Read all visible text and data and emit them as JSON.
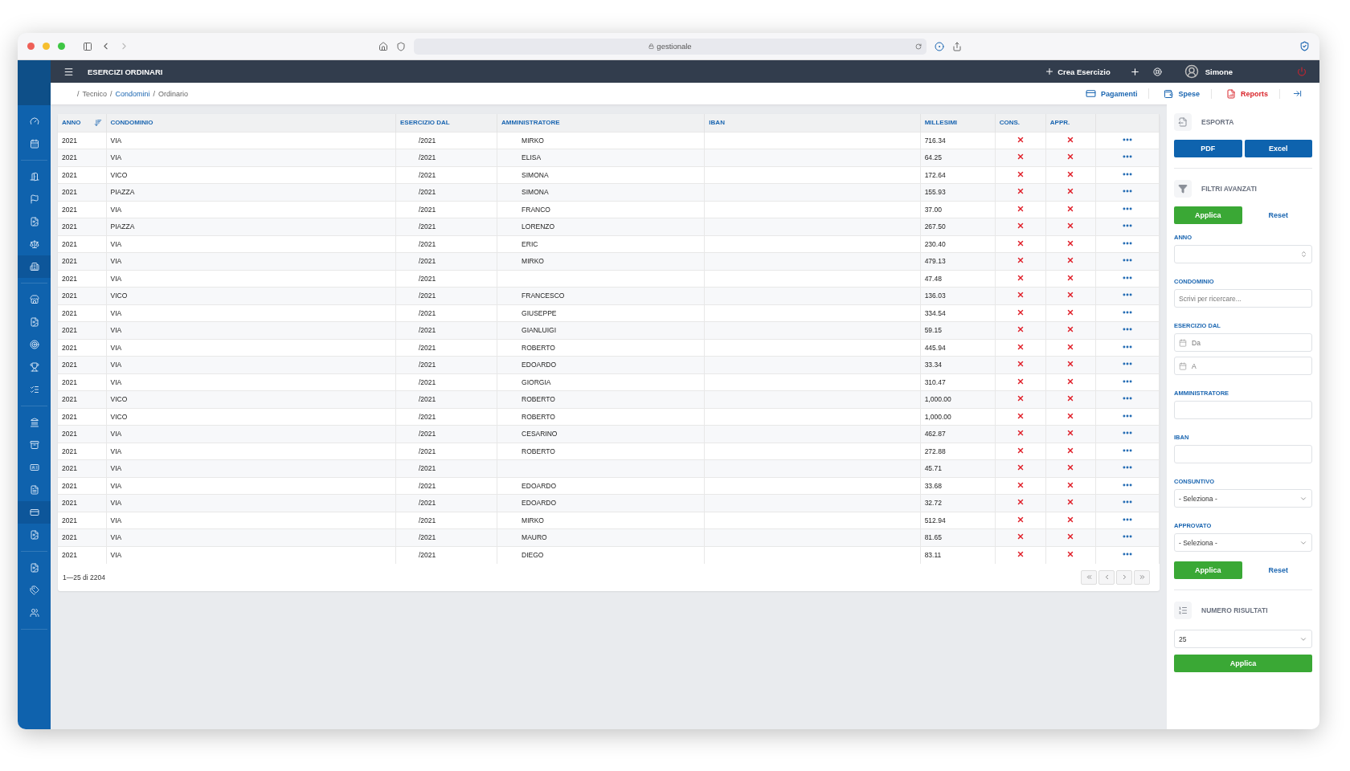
{
  "browser": {
    "url": "gestionale"
  },
  "header": {
    "title": "ESERCIZI ORDINARI",
    "create_label": "Crea Esercizio",
    "user": "Simone"
  },
  "breadcrumb": [
    {
      "label": "/",
      "kind": "sep"
    },
    {
      "label": "Tecnico",
      "kind": "text"
    },
    {
      "label": "/",
      "kind": "sep"
    },
    {
      "label": "Condomini",
      "kind": "link"
    },
    {
      "label": "/",
      "kind": "sep"
    },
    {
      "label": "Ordinario",
      "kind": "text"
    }
  ],
  "quick_links": [
    {
      "label": "Pagamenti",
      "kind": "payments"
    },
    {
      "label": "Spese",
      "kind": "expenses"
    },
    {
      "label": "Reports",
      "kind": "reports"
    }
  ],
  "sidebar": {
    "groups": [
      [
        {
          "selected": false
        },
        {
          "selected": false
        }
      ],
      [
        {
          "selected": false
        },
        {
          "selected": false
        },
        {
          "selected": false
        },
        {
          "selected": false
        },
        {
          "selected": true
        }
      ],
      [
        {
          "selected": false
        },
        {
          "selected": false
        },
        {
          "selected": false
        },
        {
          "selected": false
        },
        {
          "selected": false
        }
      ],
      [
        {
          "selected": false
        },
        {
          "selected": false
        },
        {
          "selected": false
        },
        {
          "selected": false
        },
        {
          "selected": true
        },
        {
          "selected": false
        }
      ],
      [
        {
          "selected": false
        },
        {
          "selected": false
        },
        {
          "selected": false
        }
      ]
    ]
  },
  "table": {
    "columns": [
      "ANNO",
      "CONDOMINIO",
      "ESERCIZIO DAL",
      "AMMINISTRATORE",
      "IBAN",
      "MILLESIMI",
      "CONS.",
      "APPR."
    ],
    "rows": [
      {
        "anno": "2021",
        "condominio": "VIA",
        "esercizio": "/2021",
        "amministratore": "MIRKO",
        "millesimi": "716.34",
        "cons": false,
        "appr": false
      },
      {
        "anno": "2021",
        "condominio": "VIA",
        "esercizio": "/2021",
        "amministratore": "ELISA",
        "millesimi": "64.25",
        "cons": false,
        "appr": false
      },
      {
        "anno": "2021",
        "condominio": "VICO",
        "esercizio": "/2021",
        "amministratore": "SIMONA",
        "millesimi": "172.64",
        "cons": false,
        "appr": false
      },
      {
        "anno": "2021",
        "condominio": "PIAZZA",
        "esercizio": "/2021",
        "amministratore": "SIMONA",
        "millesimi": "155.93",
        "cons": false,
        "appr": false
      },
      {
        "anno": "2021",
        "condominio": "VIA",
        "esercizio": "/2021",
        "amministratore": "FRANCO",
        "millesimi": "37.00",
        "cons": false,
        "appr": false
      },
      {
        "anno": "2021",
        "condominio": "PIAZZA",
        "esercizio": "/2021",
        "amministratore": "LORENZO",
        "millesimi": "267.50",
        "cons": false,
        "appr": false
      },
      {
        "anno": "2021",
        "condominio": "VIA",
        "esercizio": "/2021",
        "amministratore": "ERIC",
        "millesimi": "230.40",
        "cons": false,
        "appr": false
      },
      {
        "anno": "2021",
        "condominio": "VIA",
        "esercizio": "/2021",
        "amministratore": "MIRKO",
        "millesimi": "479.13",
        "cons": false,
        "appr": false
      },
      {
        "anno": "2021",
        "condominio": "VIA",
        "esercizio": "/2021",
        "millesimi": "47.48",
        "cons": false,
        "appr": false
      },
      {
        "anno": "2021",
        "condominio": "VICO",
        "esercizio": "/2021",
        "amministratore": "FRANCESCO",
        "millesimi": "136.03",
        "cons": false,
        "appr": false
      },
      {
        "anno": "2021",
        "condominio": "VIA",
        "esercizio": "/2021",
        "amministratore": "GIUSEPPE",
        "millesimi": "334.54",
        "cons": false,
        "appr": false
      },
      {
        "anno": "2021",
        "condominio": "VIA",
        "esercizio": "/2021",
        "amministratore": "GIANLUIGI",
        "millesimi": "59.15",
        "cons": false,
        "appr": false
      },
      {
        "anno": "2021",
        "condominio": "VIA",
        "esercizio": "/2021",
        "amministratore": "ROBERTO",
        "millesimi": "445.94",
        "cons": false,
        "appr": false
      },
      {
        "anno": "2021",
        "condominio": "VIA",
        "esercizio": "/2021",
        "amministratore": "EDOARDO",
        "millesimi": "33.34",
        "cons": false,
        "appr": false
      },
      {
        "anno": "2021",
        "condominio": "VIA",
        "esercizio": "/2021",
        "amministratore": "GIORGIA",
        "millesimi": "310.47",
        "cons": false,
        "appr": false
      },
      {
        "anno": "2021",
        "condominio": "VICO",
        "esercizio": "/2021",
        "amministratore": "ROBERTO",
        "millesimi": "1,000.00",
        "cons": false,
        "appr": false
      },
      {
        "anno": "2021",
        "condominio": "VICO",
        "esercizio": "/2021",
        "amministratore": "ROBERTO",
        "millesimi": "1,000.00",
        "cons": false,
        "appr": false
      },
      {
        "anno": "2021",
        "condominio": "VIA",
        "esercizio": "/2021",
        "amministratore": "CESARINO",
        "millesimi": "462.87",
        "cons": false,
        "appr": false
      },
      {
        "anno": "2021",
        "condominio": "VIA",
        "esercizio": "/2021",
        "amministratore": "ROBERTO",
        "millesimi": "272.88",
        "cons": false,
        "appr": false
      },
      {
        "anno": "2021",
        "condominio": "VIA",
        "esercizio": "/2021",
        "millesimi": "45.71",
        "cons": false,
        "appr": false
      },
      {
        "anno": "2021",
        "condominio": "VIA",
        "esercizio": "/2021",
        "amministratore": "EDOARDO",
        "millesimi": "33.68",
        "cons": false,
        "appr": false
      },
      {
        "anno": "2021",
        "condominio": "VIA",
        "esercizio": "/2021",
        "amministratore": "EDOARDO",
        "millesimi": "32.72",
        "cons": false,
        "appr": false
      },
      {
        "anno": "2021",
        "condominio": "VIA",
        "esercizio": "/2021",
        "amministratore": "MIRKO",
        "millesimi": "512.94",
        "cons": false,
        "appr": false
      },
      {
        "anno": "2021",
        "condominio": "VIA",
        "esercizio": "/2021",
        "amministratore": "MAURO",
        "millesimi": "81.65",
        "cons": false,
        "appr": false
      },
      {
        "anno": "2021",
        "condominio": "VIA",
        "esercizio": "/2021",
        "amministratore": "DIEGO",
        "millesimi": "83.11",
        "cons": false,
        "appr": false
      }
    ],
    "range": "1—25 di 2204"
  },
  "panel": {
    "export": {
      "title": "ESPORTA",
      "buttons": [
        "PDF",
        "Excel"
      ]
    },
    "filters": {
      "title": "FILTRI AVANZATI",
      "apply": "Applica",
      "reset": "Reset",
      "fields": [
        {
          "label": "ANNO",
          "kind": "number"
        },
        {
          "label": "CONDOMINIO",
          "kind": "text",
          "placeholder": "Scrivi per ricercare..."
        },
        {
          "label": "ESERCIZIO DAL",
          "kind": "date",
          "placeholder": "Da"
        },
        {
          "kind": "date",
          "placeholder": "A"
        },
        {
          "label": "AMMINISTRATORE",
          "kind": "text"
        },
        {
          "label": "IBAN",
          "kind": "text"
        },
        {
          "label": "CONSUNTIVO",
          "kind": "select",
          "value": "- Seleziona -"
        },
        {
          "label": "APPROVATO",
          "kind": "select",
          "value": "- Seleziona -"
        }
      ],
      "apply_bottom": "Applica",
      "reset_bottom": "Reset"
    },
    "results": {
      "title": "NUMERO RISULTATI",
      "value": "25",
      "apply": "Applica"
    }
  }
}
